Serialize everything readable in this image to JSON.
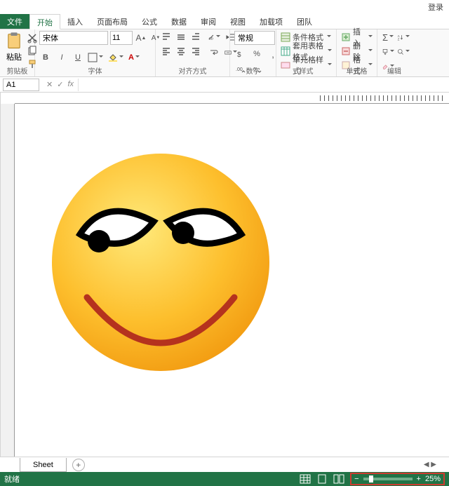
{
  "titlebar": {
    "login": "登录"
  },
  "tabs": {
    "file": "文件",
    "items": [
      "开始",
      "插入",
      "页面布局",
      "公式",
      "数据",
      "审阅",
      "视图",
      "加载项",
      "团队"
    ],
    "active_index": 0
  },
  "ribbon": {
    "clipboard": {
      "label": "剪贴板",
      "paste": "粘贴"
    },
    "font": {
      "label": "字体",
      "name": "宋体",
      "size": "11",
      "buttons": {
        "bold": "B",
        "italic": "I",
        "underline": "U"
      }
    },
    "alignment": {
      "label": "对齐方式"
    },
    "number": {
      "label": "数字",
      "format": "常规"
    },
    "styles": {
      "label": "样式",
      "conditional": "条件格式",
      "table": "套用表格格式",
      "cell": "单元格样式"
    },
    "cells": {
      "label": "单元格",
      "insert": "插入",
      "delete": "删除",
      "format": "格式"
    },
    "editing": {
      "label": "编辑"
    }
  },
  "formula_bar": {
    "cell_ref": "A1",
    "fx": "fx",
    "value": ""
  },
  "sheet_tabs": {
    "active": "Sheet",
    "add": "+"
  },
  "status": {
    "ready": "就绪",
    "zoom": "25%",
    "minus": "−",
    "plus": "+"
  }
}
